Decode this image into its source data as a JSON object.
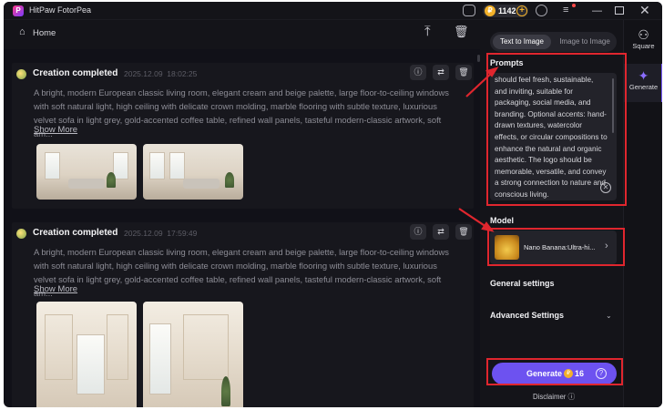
{
  "app": {
    "title": "HitPaw FotorPea",
    "credits": "1142"
  },
  "nav": {
    "home_label": "Home"
  },
  "cards": [
    {
      "title": "Creation completed",
      "date": "2025.12.09",
      "time": "18:02:25",
      "description": "A bright, modern European classic living room, elegant cream and beige palette, large floor-to-ceiling windows with soft natural light, high ceiling with delicate crown molding, marble flooring with subtle texture, luxurious velvet sofa in light grey, gold-accented coffee table, refined wall panels, tasteful modern-classic artwork, soft am...",
      "show_more": "Show More"
    },
    {
      "title": "Creation completed",
      "date": "2025.12.09",
      "time": "17:59:49",
      "description": "A bright, modern European classic living room, elegant cream and beige palette, large floor-to-ceiling windows with soft natural light, high ceiling with delicate crown molding, marble flooring with subtle texture, luxurious velvet sofa in light grey, gold-accented coffee table, refined wall panels, tasteful modern-classic artwork, soft am...",
      "show_more": "Show More"
    }
  ],
  "panel": {
    "tab_text": "Text to Image",
    "tab_image": "Image to Image",
    "prompts_label": "Prompts",
    "prompt_text": "should feel fresh, sustainable, and inviting, suitable for packaging, social media, and branding. Optional accents: hand-drawn textures, watercolor effects, or circular compositions to enhance the natural and organic aesthetic. The logo should be memorable, versatile, and convey a strong connection to nature and conscious living.",
    "model_label": "Model",
    "model_name": "Nano Banana:Ultra-hi...",
    "general_settings": "General settings",
    "advanced_settings": "Advanced Settings",
    "generate_label": "Generate",
    "generate_cost": "16",
    "disclaimer": "Disclaimer"
  },
  "rail": {
    "square_label": "Square",
    "generate_label": "Generate"
  },
  "colors": {
    "accent": "#6d52f0",
    "highlight": "#e0262e",
    "background": "#111118"
  }
}
